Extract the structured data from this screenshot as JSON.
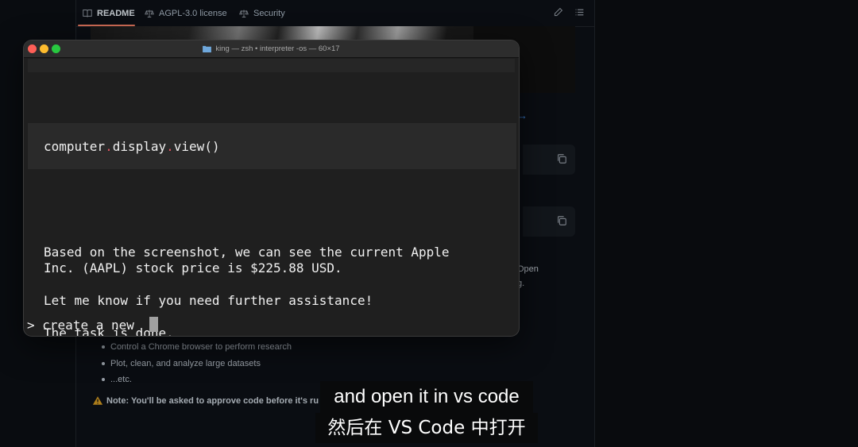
{
  "github": {
    "tabs": [
      {
        "label": "README",
        "icon": "book-icon",
        "active": true
      },
      {
        "label": "AGPL-3.0 license",
        "icon": "scale-icon",
        "active": false
      },
      {
        "label": "Security",
        "icon": "scale-icon",
        "active": false
      }
    ],
    "link_text": "→",
    "side_text": [
      "Open",
      "g."
    ],
    "bullets": [
      "Control a Chrome browser to perform research",
      "Plot, clean, and analyze large datasets",
      "...etc."
    ],
    "note": "Note: You'll be asked to approve code before it's ru"
  },
  "terminal": {
    "title": "king — zsh • interpreter -os — 60×17",
    "code": {
      "part1": "computer",
      "dot": ".",
      "part2": "display",
      "part3": "view()"
    },
    "output": [
      "Based on the screenshot, we can see the current Apple",
      "Inc. (AAPL) stock price is $225.88 USD.",
      "Let me know if you need further assistance!",
      "The task is done."
    ],
    "prompt_symbol": ">",
    "input_text": "create a new"
  },
  "subtitles": {
    "en": "and open it in vs code",
    "zh": "然后在 VS Code 中打开"
  },
  "colors": {
    "accent_tab": "#f78166",
    "link": "#4493f8",
    "code_dot": "#e05561"
  }
}
